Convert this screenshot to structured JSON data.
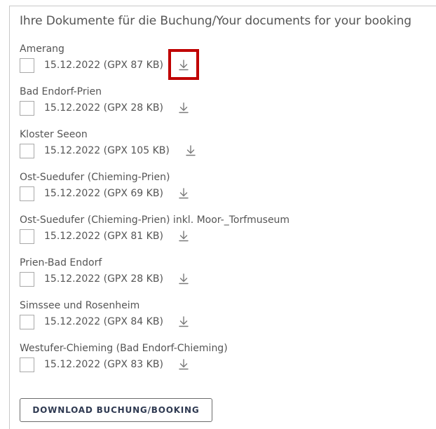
{
  "section": {
    "title": "Ihre Dokumente für die Buchung/Your documents for your booking"
  },
  "documents": [
    {
      "name": "Amerang",
      "date": "15.12.2022",
      "info": "15.12.2022 (GPX 87 KB)"
    },
    {
      "name": "Bad Endorf-Prien",
      "date": "15.12.2022",
      "info": "15.12.2022 (GPX 28 KB)"
    },
    {
      "name": "Kloster Seeon",
      "date": "15.12.2022",
      "info": "15.12.2022 (GPX 105 KB)"
    },
    {
      "name": "Ost-Suedufer (Chieming-Prien)",
      "date": "15.12.2022",
      "info": "15.12.2022 (GPX 69 KB)"
    },
    {
      "name": "Ost-Suedufer (Chieming-Prien) inkl. Moor-_Torfmuseum",
      "date": "15.12.2022",
      "info": "15.12.2022 (GPX 81 KB)"
    },
    {
      "name": "Prien-Bad Endorf",
      "date": "15.12.2022",
      "info": "15.12.2022 (GPX 28 KB)"
    },
    {
      "name": "Simssee und Rosenheim",
      "date": "15.12.2022",
      "info": "15.12.2022 (GPX 84 KB)"
    },
    {
      "name": "Westufer-Chieming (Bad Endorf-Chieming)",
      "date": "15.12.2022",
      "info": "15.12.2022 (GPX 83 KB)"
    }
  ],
  "icons": {
    "download": "download-icon",
    "checkbox": "checkbox"
  },
  "colors": {
    "highlight": "#c00000",
    "text": "#555555",
    "icon": "#7a7a7a",
    "button_text": "#2f3a52"
  },
  "footer": {
    "download_button_label": "DOWNLOAD BUCHUNG/BOOKING"
  }
}
